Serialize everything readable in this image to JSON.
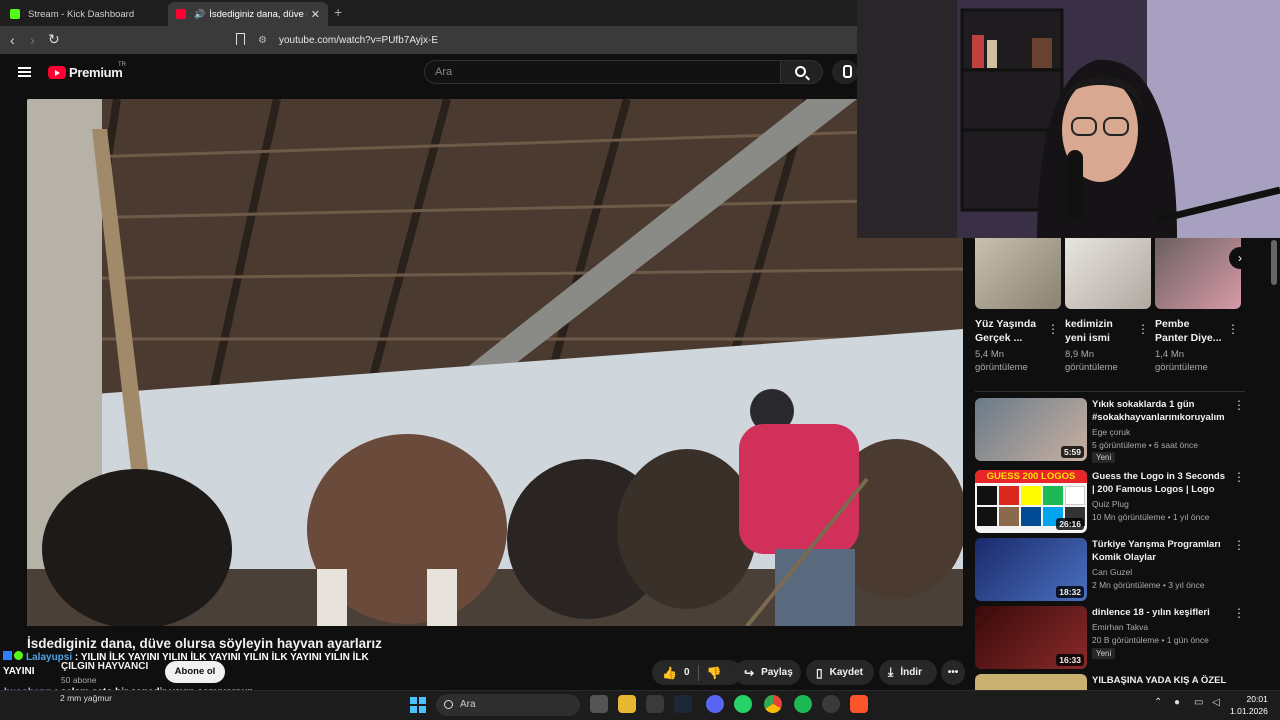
{
  "browser": {
    "tabs": [
      {
        "label": "Stream - Kick Dashboard",
        "close": ""
      },
      {
        "label": "İsdediginiz dana, düve olursa",
        "close": "✕"
      }
    ],
    "new_tab": "+",
    "url": "youtube.com/watch?v=PUfb7Ayjx-E"
  },
  "youtube": {
    "brand": "Premium",
    "country": "TR",
    "search_placeholder": "Ara"
  },
  "video": {
    "title": "İsdediginiz dana, düve olursa söyleyin hayvan ayarlarız",
    "channel": "ÇILGIN HAYVANCI",
    "subscribers": "50 abone",
    "subscribe_label": "Abone ol",
    "like_count": "0",
    "share_label": "Paylaş",
    "save_label": "Kaydet",
    "download_label": "İndir",
    "more_label": "•••"
  },
  "shorts": [
    {
      "title": "Yüz Yaşında Gerçek ...",
      "views": "5,4 Mn görüntüleme"
    },
    {
      "title": "kedimizin yeni ismi",
      "views": "8,9 Mn görüntüleme"
    },
    {
      "title": "Pembe Panter Diye...",
      "views": "1,4 Mn görüntüleme"
    }
  ],
  "recommendations": [
    {
      "title": "Yıkık sokaklarda 1 gün #sokakhayvanlarınıkoruyalım ...",
      "channel": "Ege çoruk",
      "meta": "5 görüntüleme • 6 saat önce",
      "badge": "Yeni",
      "duration": "5:59"
    },
    {
      "title": "Guess the Logo in 3 Seconds | 200 Famous Logos | Logo Qui...",
      "channel": "Quiz Plug",
      "meta": "10 Mn görüntüleme • 1 yıl önce",
      "badge": "",
      "duration": "26:16",
      "thumb_text": "GUESS 200 LOGOS"
    },
    {
      "title": "Türkiye Yarışma Programları Komik Olaylar",
      "channel": "Can Guzel",
      "meta": "2 Mn görüntüleme • 3 yıl önce",
      "badge": "",
      "duration": "18:32"
    },
    {
      "title": "dinlence 18 - yılın keşifleri",
      "channel": "Emirhan Takva",
      "meta": "20 B görüntüleme • 1 gün önce",
      "badge": "Yeni",
      "duration": "16:33"
    },
    {
      "title": "YILBAŞINA YADA KIŞ A ÖZEL",
      "channel": "",
      "meta": "",
      "badge": "",
      "duration": ""
    }
  ],
  "chat": [
    {
      "user": "Lalayupsi",
      "text": ": YILIN İLK YAYINI YILIN İLK YAYINI YILIN İLK YAYINI YILIN İLK YAYINI"
    },
    {
      "user": "busobenn",
      "text": ": selam çato bir senedir yayın açmıyorsun"
    },
    {
      "user": "busobenn",
      "text": ":"
    }
  ],
  "taskbar": {
    "weather": "2 mm yağmur",
    "search": "Ara",
    "time": "20:01",
    "date": "1.01.2026"
  },
  "colors": {
    "yt_red": "#ff0033",
    "background": "#0f0f0f",
    "chat_user": "#4fa3e8"
  }
}
